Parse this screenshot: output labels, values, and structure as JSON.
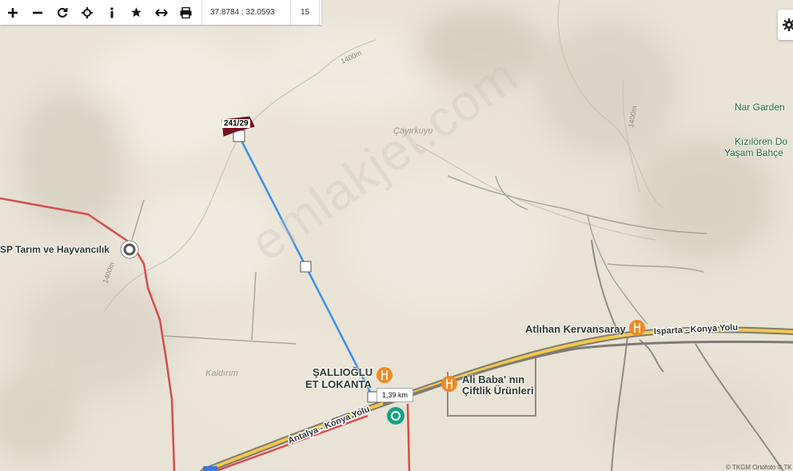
{
  "toolbar": {
    "coordinates": "37.8784 : 32.0593",
    "zoom": "15"
  },
  "map": {
    "parcel_label": "241/29",
    "distance_label": "1,39 km",
    "watermark": "emlakjet.com",
    "attribution": "© TKGM Ortofoto © TK",
    "contour_labels": [
      "1400m",
      "1400m",
      "1400m"
    ],
    "area_labels": [
      "Çayırkuyu",
      "Kaldırım"
    ],
    "road_labels": [
      "Isparta - Konya Yolu",
      "Antalya - Konya Yolu"
    ],
    "poi_labels": {
      "tarim": "SP Tarım ve Hayvancılık",
      "sallioglu_1": "ŞALLIOĞLU",
      "sallioglu_2": "ET LOKANTA",
      "alibaba_1": "Ali Baba' nın",
      "alibaba_2": "Çiftlik Ürünleri",
      "atlihan": "Atlıhan Kervansaray",
      "nargarden": "Nar Garden",
      "kiziloren_1": "Kızılören Do",
      "kiziloren_2": "Yaşam Bahçe"
    },
    "colors": {
      "base": "#e9e3d6",
      "measure_line": "#3b8ee8",
      "boundary": "#d94b4b",
      "parcel": "#7a1020",
      "poi_orange": "#f08a24",
      "poi_green": "#16a085"
    }
  }
}
